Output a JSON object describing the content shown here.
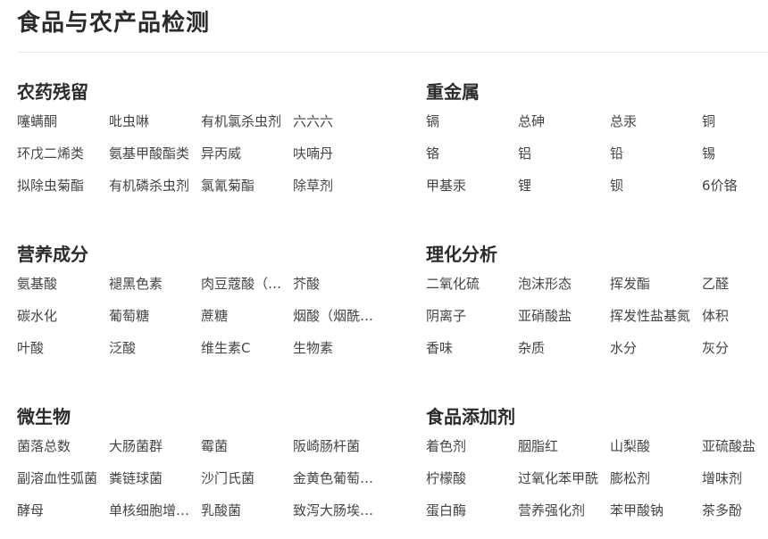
{
  "page": {
    "title": "食品与农产品检测"
  },
  "sections": [
    {
      "title": "农药残留",
      "items": [
        "噻螨酮",
        "吡虫啉",
        "有机氯杀虫剂",
        "六六六",
        "环戊二烯类",
        "氨基甲酸酯类",
        "异丙威",
        "呋喃丹",
        "拟除虫菊酯",
        "有机磷杀虫剂",
        "氯氰菊酯",
        "除草剂"
      ]
    },
    {
      "title": "重金属",
      "items": [
        "镉",
        "总砷",
        "总汞",
        "铜",
        "铬",
        "铝",
        "铅",
        "锡",
        "甲基汞",
        "锂",
        "钡",
        "6价铬"
      ]
    },
    {
      "title": "营养成分",
      "items": [
        "氨基酸",
        "褪黑色素",
        "肉豆蔻酸（十四酸）",
        "芥酸",
        "碳水化",
        "葡萄糖",
        "蔗糖",
        "烟酸（烟酰胺）",
        "叶酸",
        "泛酸",
        "维生素C",
        "生物素"
      ]
    },
    {
      "title": "理化分析",
      "items": [
        "二氧化硫",
        "泡沫形态",
        "挥发酯",
        "乙醛",
        "阴离子",
        "亚硝酸盐",
        "挥发性盐基氮",
        "体积",
        "香味",
        "杂质",
        "水分",
        "灰分"
      ]
    },
    {
      "title": "微生物",
      "items": [
        "菌落总数",
        "大肠菌群",
        "霉菌",
        "阪崎肠杆菌",
        "副溶血性弧菌",
        "粪链球菌",
        "沙门氏菌",
        "金黄色葡萄球菌",
        "酵母",
        "单核细胞增生李斯特菌",
        "乳酸菌",
        "致泻大肠埃希氏菌"
      ]
    },
    {
      "title": "食品添加剂",
      "items": [
        "着色剂",
        "胭脂红",
        "山梨酸",
        "亚硫酸盐",
        "柠檬酸",
        "过氧化苯甲酰",
        "膨松剂",
        "增味剂",
        "蛋白酶",
        "营养强化剂",
        "苯甲酸钠",
        "茶多酚"
      ]
    }
  ]
}
